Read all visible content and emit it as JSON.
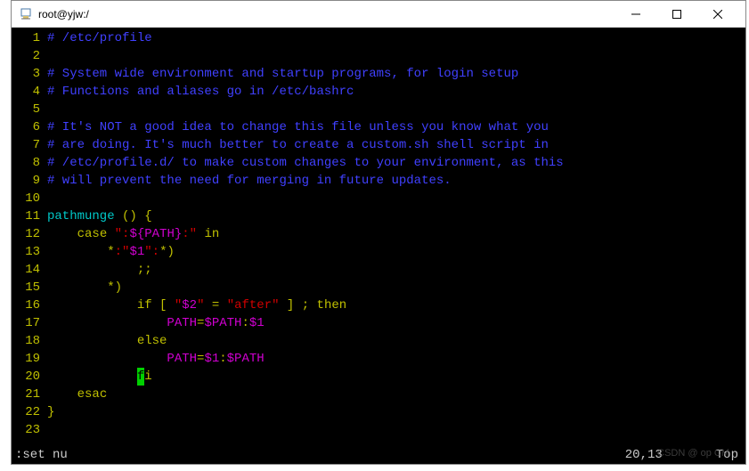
{
  "window": {
    "title": "root@yjw:/"
  },
  "editor": {
    "lines": [
      {
        "num": "1",
        "segs": [
          {
            "cls": "comment",
            "txt": "# /etc/profile"
          }
        ]
      },
      {
        "num": "2",
        "segs": []
      },
      {
        "num": "3",
        "segs": [
          {
            "cls": "comment",
            "txt": "# System wide environment and startup programs, for login setup"
          }
        ]
      },
      {
        "num": "4",
        "segs": [
          {
            "cls": "comment",
            "txt": "# Functions and aliases go in /etc/bashrc"
          }
        ]
      },
      {
        "num": "5",
        "segs": []
      },
      {
        "num": "6",
        "segs": [
          {
            "cls": "comment",
            "txt": "# It's NOT a good idea to change this file unless you know what you"
          }
        ]
      },
      {
        "num": "7",
        "segs": [
          {
            "cls": "comment",
            "txt": "# are doing. It's much better to create a custom.sh shell script in"
          }
        ]
      },
      {
        "num": "8",
        "segs": [
          {
            "cls": "comment",
            "txt": "# /etc/profile.d/ to make custom changes to your environment, as this"
          }
        ]
      },
      {
        "num": "9",
        "segs": [
          {
            "cls": "comment",
            "txt": "# will prevent the need for merging in future updates."
          }
        ]
      },
      {
        "num": "10",
        "segs": []
      },
      {
        "num": "11",
        "segs": [
          {
            "cls": "cyan",
            "txt": "pathmunge "
          },
          {
            "cls": "yellow",
            "txt": "()"
          },
          {
            "cls": "white",
            "txt": " "
          },
          {
            "cls": "yellow",
            "txt": "{"
          }
        ]
      },
      {
        "num": "12",
        "segs": [
          {
            "cls": "white",
            "txt": "    "
          },
          {
            "cls": "yellow",
            "txt": "case"
          },
          {
            "cls": "white",
            "txt": " "
          },
          {
            "cls": "red",
            "txt": "\":"
          },
          {
            "cls": "magenta",
            "txt": "${PATH}"
          },
          {
            "cls": "red",
            "txt": ":\""
          },
          {
            "cls": "white",
            "txt": " "
          },
          {
            "cls": "yellow",
            "txt": "in"
          }
        ]
      },
      {
        "num": "13",
        "segs": [
          {
            "cls": "white",
            "txt": "        "
          },
          {
            "cls": "yellow",
            "txt": "*"
          },
          {
            "cls": "red",
            "txt": ":\""
          },
          {
            "cls": "magenta",
            "txt": "$1"
          },
          {
            "cls": "red",
            "txt": "\":"
          },
          {
            "cls": "yellow",
            "txt": "*)"
          }
        ]
      },
      {
        "num": "14",
        "segs": [
          {
            "cls": "white",
            "txt": "            "
          },
          {
            "cls": "yellow",
            "txt": ";;"
          }
        ]
      },
      {
        "num": "15",
        "segs": [
          {
            "cls": "white",
            "txt": "        "
          },
          {
            "cls": "yellow",
            "txt": "*)"
          }
        ]
      },
      {
        "num": "16",
        "segs": [
          {
            "cls": "white",
            "txt": "            "
          },
          {
            "cls": "yellow",
            "txt": "if"
          },
          {
            "cls": "white",
            "txt": " "
          },
          {
            "cls": "yellow",
            "txt": "["
          },
          {
            "cls": "white",
            "txt": " "
          },
          {
            "cls": "red",
            "txt": "\""
          },
          {
            "cls": "magenta",
            "txt": "$2"
          },
          {
            "cls": "red",
            "txt": "\""
          },
          {
            "cls": "white",
            "txt": " "
          },
          {
            "cls": "yellow",
            "txt": "="
          },
          {
            "cls": "white",
            "txt": " "
          },
          {
            "cls": "red",
            "txt": "\"after\""
          },
          {
            "cls": "white",
            "txt": " "
          },
          {
            "cls": "yellow",
            "txt": "]"
          },
          {
            "cls": "white",
            "txt": " "
          },
          {
            "cls": "yellow",
            "txt": ";"
          },
          {
            "cls": "white",
            "txt": " "
          },
          {
            "cls": "yellow",
            "txt": "then"
          }
        ]
      },
      {
        "num": "17",
        "segs": [
          {
            "cls": "white",
            "txt": "                "
          },
          {
            "cls": "magenta",
            "txt": "PATH"
          },
          {
            "cls": "yellow",
            "txt": "="
          },
          {
            "cls": "magenta",
            "txt": "$PATH"
          },
          {
            "cls": "yellow",
            "txt": ":"
          },
          {
            "cls": "magenta",
            "txt": "$1"
          }
        ]
      },
      {
        "num": "18",
        "segs": [
          {
            "cls": "white",
            "txt": "            "
          },
          {
            "cls": "yellow",
            "txt": "else"
          }
        ]
      },
      {
        "num": "19",
        "segs": [
          {
            "cls": "white",
            "txt": "                "
          },
          {
            "cls": "magenta",
            "txt": "PATH"
          },
          {
            "cls": "yellow",
            "txt": "="
          },
          {
            "cls": "magenta",
            "txt": "$1"
          },
          {
            "cls": "yellow",
            "txt": ":"
          },
          {
            "cls": "magenta",
            "txt": "$PATH"
          }
        ]
      },
      {
        "num": "20",
        "segs": [
          {
            "cls": "white",
            "txt": "            "
          },
          {
            "cls": "cursor",
            "txt": "f"
          },
          {
            "cls": "yellow",
            "txt": "i"
          }
        ]
      },
      {
        "num": "21",
        "segs": [
          {
            "cls": "white",
            "txt": "    "
          },
          {
            "cls": "yellow",
            "txt": "esac"
          }
        ]
      },
      {
        "num": "22",
        "segs": [
          {
            "cls": "yellow",
            "txt": "}"
          }
        ]
      },
      {
        "num": "23",
        "segs": []
      }
    ]
  },
  "status": {
    "command": ":set nu",
    "position": "20,13",
    "mode": "Top"
  },
  "watermark": "CSDN @ op CM"
}
